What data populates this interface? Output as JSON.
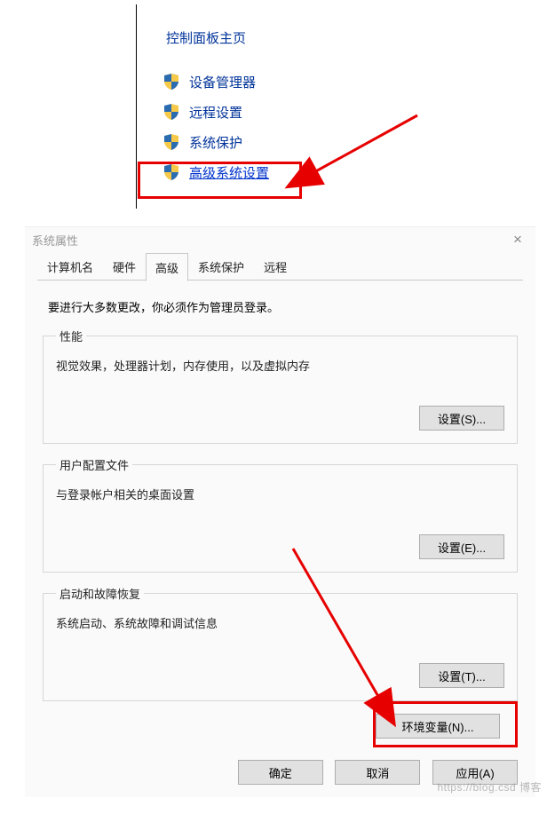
{
  "control_panel": {
    "title": "控制面板主页",
    "items": [
      {
        "label": "设备管理器"
      },
      {
        "label": "远程设置"
      },
      {
        "label": "系统保护"
      },
      {
        "label": "高级系统设置"
      }
    ]
  },
  "dialog": {
    "title": "系统属性",
    "tabs": [
      "计算机名",
      "硬件",
      "高级",
      "系统保护",
      "远程"
    ],
    "active_tab": "高级",
    "admin_note": "要进行大多数更改，你必须作为管理员登录。",
    "groups": {
      "performance": {
        "legend": "性能",
        "desc": "视觉效果，处理器计划，内存使用，以及虚拟内存",
        "button": "设置(S)..."
      },
      "user_profiles": {
        "legend": "用户配置文件",
        "desc": "与登录帐户相关的桌面设置",
        "button": "设置(E)..."
      },
      "startup": {
        "legend": "启动和故障恢复",
        "desc": "系统启动、系统故障和调试信息",
        "button": "设置(T)..."
      }
    },
    "env_button": "环境变量(N)...",
    "footer": {
      "ok": "确定",
      "cancel": "取消",
      "apply": "应用(A)"
    }
  },
  "watermark": "https://blog.csd    博客",
  "annotation_color": "#e60000"
}
